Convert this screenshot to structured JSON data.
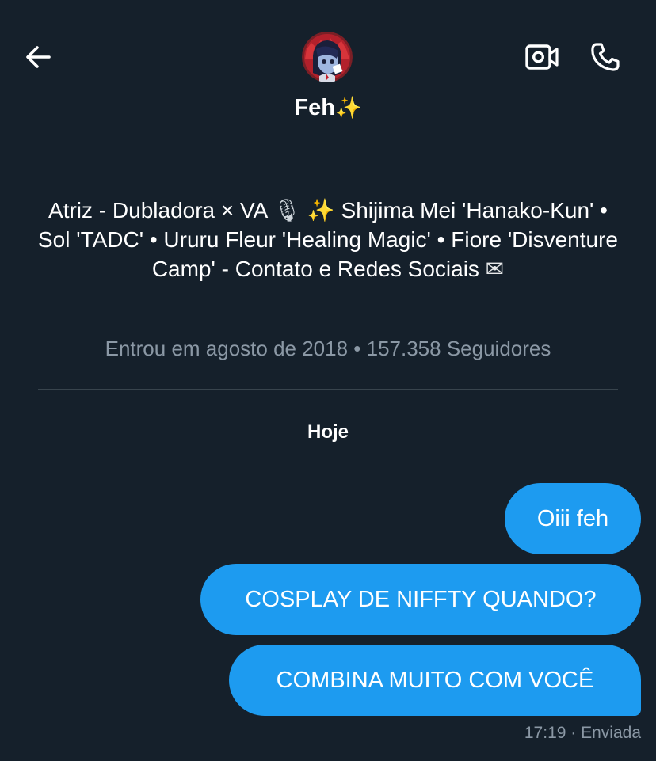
{
  "header": {
    "name": "Feh",
    "name_emoji": "✨",
    "back_icon": "arrow-left-icon",
    "video_icon": "video-camera-icon",
    "call_icon": "phone-icon",
    "avatar_alt": "profile-avatar"
  },
  "profile": {
    "bio_part1": "Atriz - Dubladora × VA",
    "bio_mic": "🎙",
    "bio_sparkle": "✨",
    "bio_part2": "Shijima Mei 'Hanako-Kun' • Sol 'TADC' • Ururu Fleur 'Healing Magic' • Fiore 'Disventure Camp' - Contato e Redes Sociais",
    "bio_envelope": "✉",
    "meta": "Entrou em agosto de 2018 • 157.358 Seguidores"
  },
  "conversation": {
    "day_label": "Hoje",
    "messages": [
      {
        "text": "Oiii feh"
      },
      {
        "text": "COSPLAY DE NIFFTY QUANDO?"
      },
      {
        "text": "COMBINA MUITO COM VOCÊ"
      }
    ],
    "time": "17:19",
    "status": "· Enviada"
  },
  "colors": {
    "background": "#15202b",
    "bubble": "#1d9bf0",
    "muted_text": "#8b98a5",
    "divider": "#38444d"
  }
}
